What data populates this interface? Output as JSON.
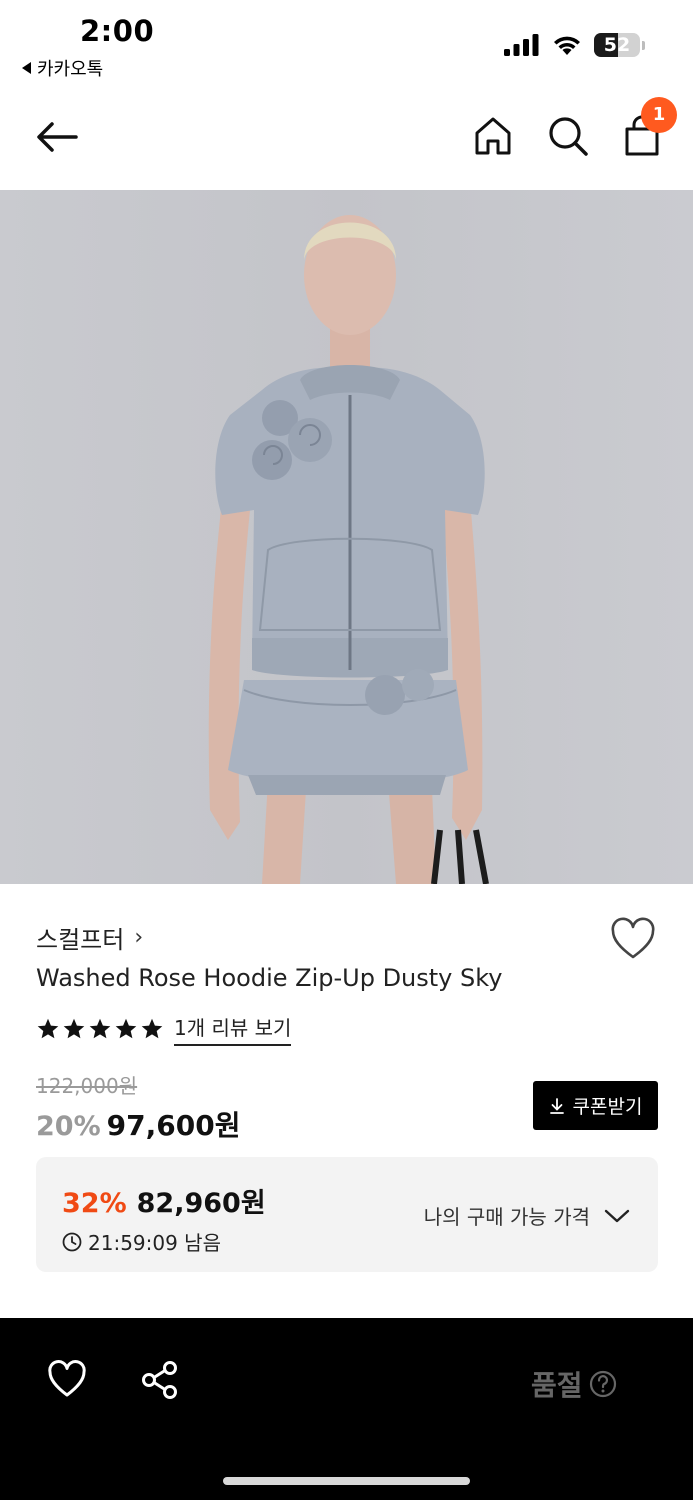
{
  "status_bar": {
    "time": "2:00",
    "back_app": "카카오톡",
    "battery": "52",
    "battery_level": 0.52,
    "icons": [
      "signal-icon",
      "wifi-icon",
      "battery-icon"
    ]
  },
  "nav": {
    "icons": [
      "back-arrow-icon",
      "home-icon",
      "search-icon",
      "cart-icon"
    ],
    "cart_count": "1"
  },
  "product": {
    "brand": "스컬프터",
    "brand_chevron": "›",
    "title": "Washed Rose Hoodie Zip-Up Dusty Sky",
    "rating_stars": 5,
    "review_link": "1개 리뷰 보기",
    "original_price": "122,000원",
    "discount_rate": "20%",
    "sale_price": "97,600원",
    "coupon_button": "쿠폰받기"
  },
  "best_price": {
    "rate": "32%",
    "price": "82,960원",
    "timer": "21:59:09 남음",
    "my_price_label": "나의 구매 가능 가격"
  },
  "bottom_bar": {
    "status": "품절",
    "icons": [
      "heart-icon",
      "share-icon",
      "help-icon"
    ]
  },
  "colors": {
    "accent": "#f04a14",
    "badge": "#ff5a1f",
    "image_bg": "#c4c5ca",
    "garment": "#a6afbd",
    "bottom_bar": "#000000"
  }
}
